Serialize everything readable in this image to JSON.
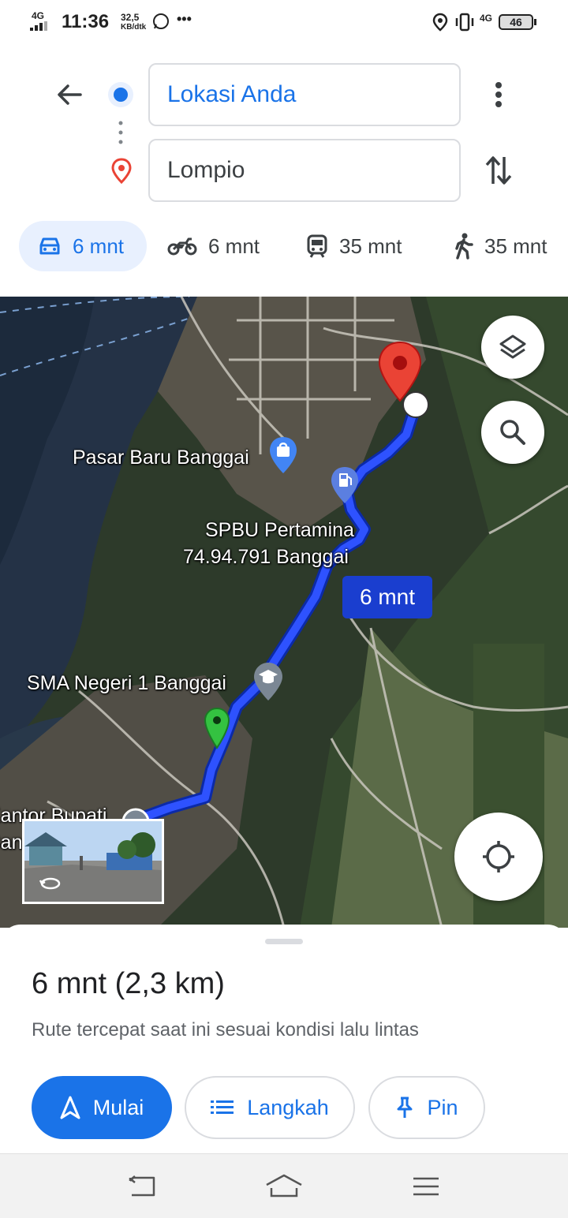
{
  "status_bar": {
    "network": "4G",
    "time": "11:36",
    "speed_value": "32,5",
    "speed_unit": "KB/dtk",
    "more": "•••",
    "network_right": "4G",
    "battery": "46"
  },
  "directions": {
    "origin": "Lokasi Anda",
    "destination": "Lompio"
  },
  "modes": [
    {
      "name": "car",
      "time": "6 mnt",
      "selected": true
    },
    {
      "name": "motorcycle",
      "time": "6 mnt"
    },
    {
      "name": "transit",
      "time": "35 mnt"
    },
    {
      "name": "walk",
      "time": "35 mnt"
    }
  ],
  "map": {
    "labels": {
      "market": "Pasar Baru Banggai",
      "gas_line1": "SPBU Pertamina",
      "gas_line2": "74.94.791 Banggai",
      "school": "SMA Negeri 1 Banggai",
      "office_line1": "Kantor Bupati",
      "office_line2": "Ban"
    },
    "route_time": "6 mnt",
    "icons": [
      "layers-icon",
      "search-icon",
      "my-location-icon",
      "shopping-bag-icon",
      "gas-station-icon",
      "school-icon",
      "destination-pin-icon"
    ]
  },
  "sheet": {
    "summary": "6 mnt (2,3 km)",
    "subtitle": "Rute tercepat saat ini sesuai kondisi lalu lintas",
    "start_label": "Mulai",
    "steps_label": "Langkah",
    "pin_label": "Pin"
  },
  "colors": {
    "accent": "#1a73e8",
    "route": "#1a3ecf",
    "destination_pin": "#ea4335"
  }
}
